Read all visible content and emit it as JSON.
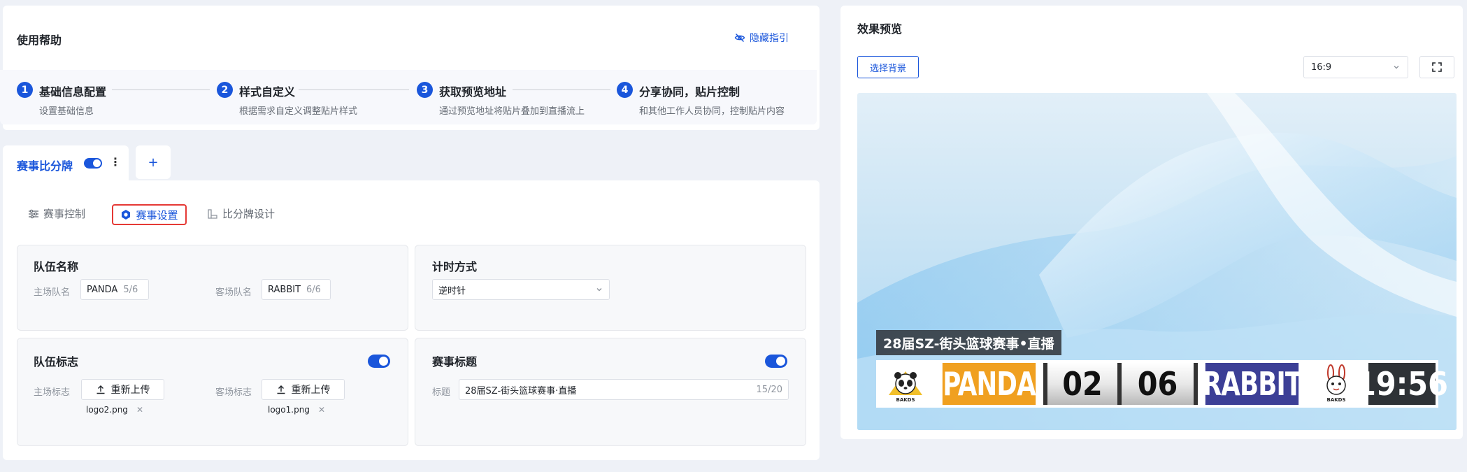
{
  "help": {
    "title": "使用帮助",
    "hide_label": "隐藏指引",
    "steps": [
      {
        "num": "1",
        "title": "基础信息配置",
        "desc": "设置基础信息"
      },
      {
        "num": "2",
        "title": "样式自定义",
        "desc": "根据需求自定义调整贴片样式"
      },
      {
        "num": "3",
        "title": "获取预览地址",
        "desc": "通过预览地址将贴片叠加到直播流上"
      },
      {
        "num": "4",
        "title": "分享协同，贴片控制",
        "desc": "和其他工作人员协同，控制贴片内容"
      }
    ]
  },
  "tabs": {
    "active_label": "赛事比分牌",
    "add_label": "+"
  },
  "subtabs": [
    {
      "label": "赛事控制",
      "icon": "sliders-icon"
    },
    {
      "label": "赛事设置",
      "icon": "hexagon-settings-icon"
    },
    {
      "label": "比分牌设计",
      "icon": "design-icon"
    }
  ],
  "team_names": {
    "title": "队伍名称",
    "home_label": "主场队名",
    "home_value": "PANDA",
    "home_count": "5/6",
    "away_label": "客场队名",
    "away_value": "RABBIT",
    "away_count": "6/6"
  },
  "timing": {
    "title": "计时方式",
    "value": "逆时针"
  },
  "team_logos": {
    "title": "队伍标志",
    "home_label": "主场标志",
    "away_label": "客场标志",
    "upload_label": "重新上传",
    "home_file": "logo2.png",
    "away_file": "logo1.png"
  },
  "match_title": {
    "title": "赛事标题",
    "label": "标题",
    "value": "28届SZ-街头篮球赛事·直播",
    "count": "15/20"
  },
  "preview": {
    "title": "效果预览",
    "bg_button": "选择背景",
    "ratio": "16:9"
  },
  "scoreboard": {
    "title": "28届SZ-街头篮球赛事•直播",
    "home_team": "PANDA",
    "home_score": "02",
    "away_score": "06",
    "away_team": "RABBIT",
    "clock": "19:56",
    "home_logo_text": "BAKDS",
    "away_logo_text": "BAKDS",
    "home_color": "#f0a020",
    "away_color": "#3c3f96"
  },
  "colors": {
    "accent": "#1a56db",
    "highlight_border": "#e53935"
  }
}
